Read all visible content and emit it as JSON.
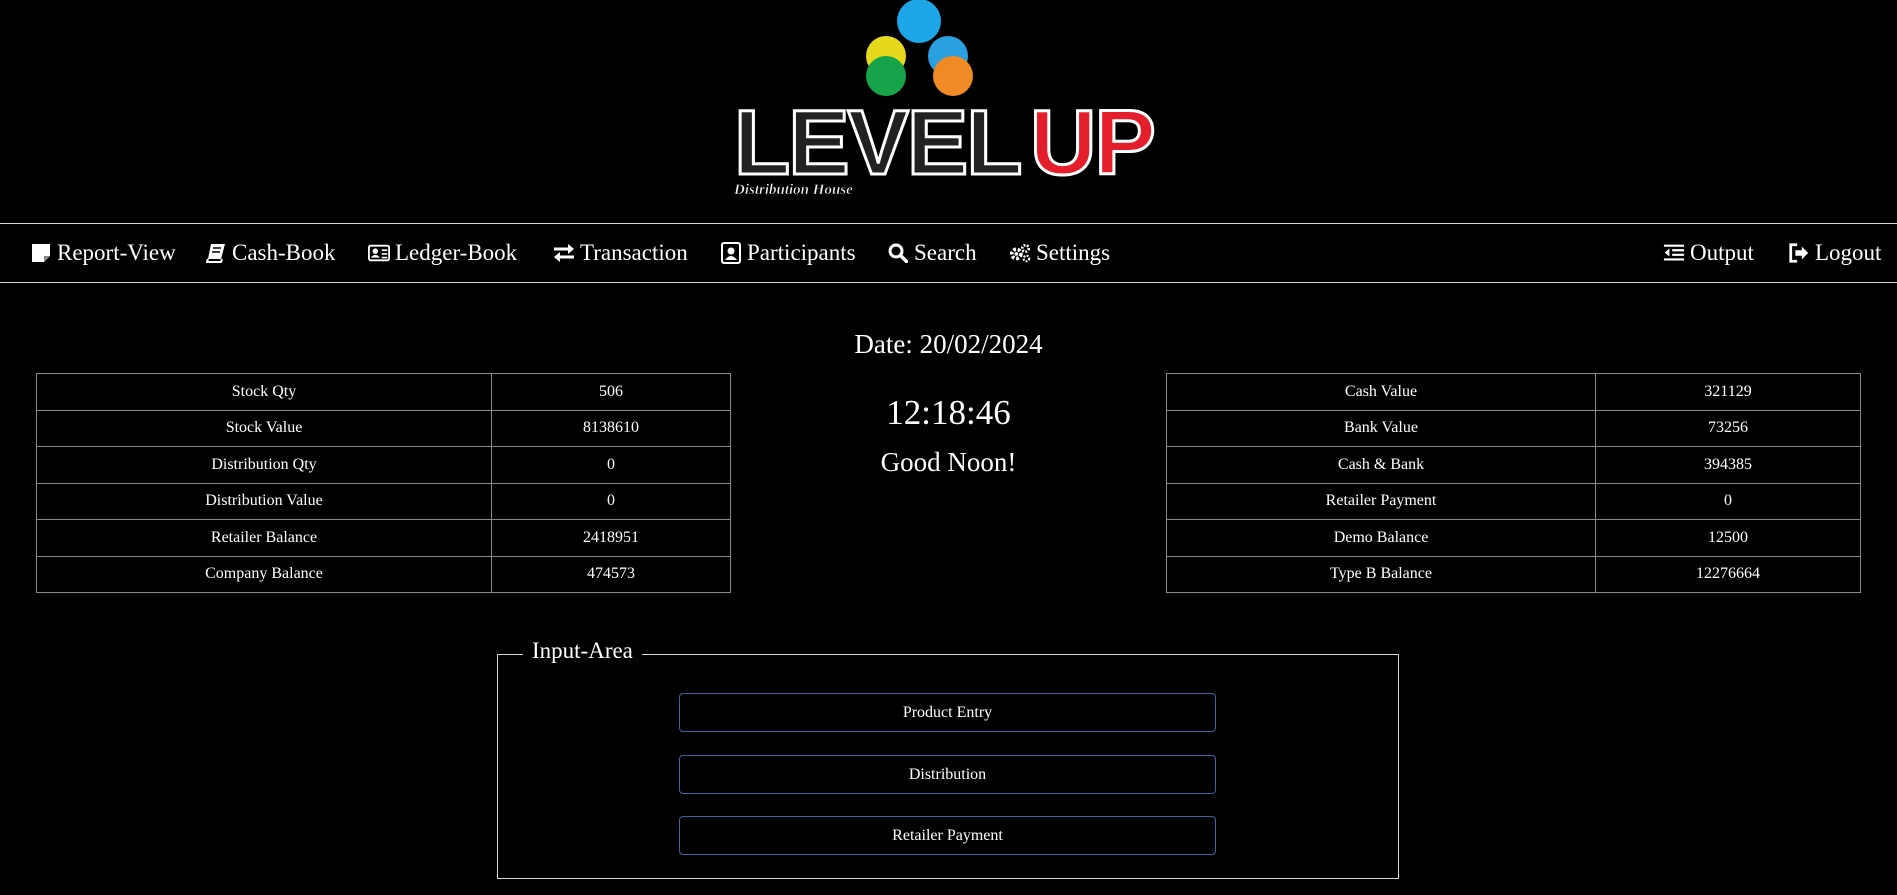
{
  "brand": {
    "name_main": "LEVEL",
    "name_accent": "UP",
    "tagline": "Distribution House",
    "accent_color": "#e41e2b"
  },
  "nav": {
    "left": [
      {
        "label": "Report-View",
        "icon": "sticky-note-icon"
      },
      {
        "label": "Cash-Book",
        "icon": "book-icon"
      },
      {
        "label": "Ledger-Book",
        "icon": "id-card-icon"
      },
      {
        "label": "Transaction",
        "icon": "exchange-arrows-icon"
      },
      {
        "label": "Participants",
        "icon": "user-badge-icon"
      },
      {
        "label": "Search",
        "icon": "search-icon"
      },
      {
        "label": "Settings",
        "icon": "gears-icon"
      }
    ],
    "right": [
      {
        "label": "Output",
        "icon": "outdent-icon"
      },
      {
        "label": "Logout",
        "icon": "sign-out-icon"
      }
    ]
  },
  "header": {
    "date": "Date: 20/02/2024",
    "time": "12:18:46",
    "greeting": "Good Noon!"
  },
  "left_stats": [
    {
      "label": "Stock Qty",
      "value": "506"
    },
    {
      "label": "Stock Value",
      "value": "8138610"
    },
    {
      "label": "Distribution Qty",
      "value": "0"
    },
    {
      "label": "Distribution Value",
      "value": "0"
    },
    {
      "label": "Retailer Balance",
      "value": "2418951"
    },
    {
      "label": "Company Balance",
      "value": "474573"
    }
  ],
  "right_stats": [
    {
      "label": "Cash Value",
      "value": "321129"
    },
    {
      "label": "Bank Value",
      "value": "73256"
    },
    {
      "label": "Cash & Bank",
      "value": "394385"
    },
    {
      "label": "Retailer Payment",
      "value": "0"
    },
    {
      "label": "Demo Balance",
      "value": "12500"
    },
    {
      "label": "Type B Balance",
      "value": "12276664"
    }
  ],
  "input_area": {
    "legend": "Input-Area",
    "buttons": [
      "Product Entry",
      "Distribution",
      "Retailer Payment"
    ]
  }
}
